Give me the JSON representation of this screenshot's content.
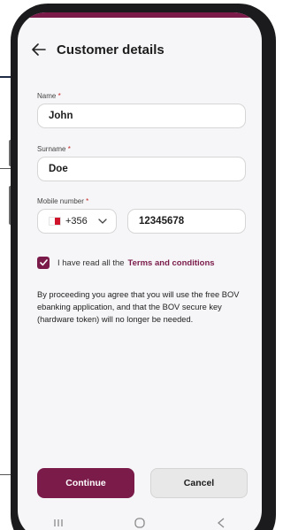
{
  "header": {
    "title": "Customer details"
  },
  "form": {
    "name": {
      "label": "Name",
      "required_mark": "*",
      "value": "John"
    },
    "surname": {
      "label": "Surname",
      "required_mark": "*",
      "value": "Doe"
    },
    "mobile": {
      "label": "Mobile number",
      "required_mark": "*",
      "country_code": "+356",
      "value": "12345678"
    }
  },
  "agreement": {
    "checked": true,
    "text": "I have read all the",
    "link": "Terms and conditions"
  },
  "notice": "By proceeding you agree that you will use the free BOV ebanking application, and that the BOV secure key (hardware token) will no longer be needed.",
  "buttons": {
    "continue": "Continue",
    "cancel": "Cancel"
  },
  "colors": {
    "brand": "#7a1b4a",
    "flag_red": "#cf142b"
  },
  "icons": [
    "back-arrow-icon",
    "chevron-down-icon",
    "checkmark-icon",
    "recents-icon",
    "home-icon",
    "back-nav-icon"
  ]
}
